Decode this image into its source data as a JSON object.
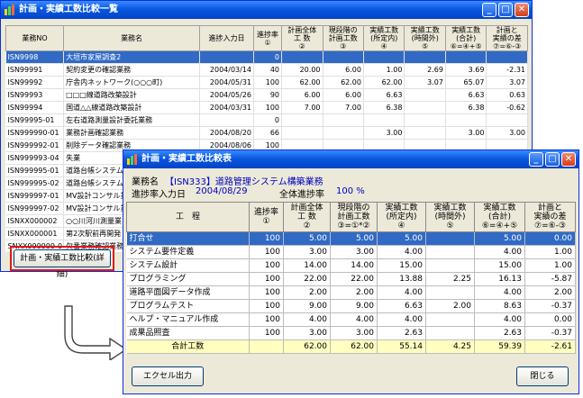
{
  "back_window": {
    "title": "計画・実績工数比較一覧",
    "headers": [
      "業務NO",
      "業務名",
      "進捗入力日",
      "進捗率\n①",
      "計画全体\n工 数\n②",
      "現段階の\n計画工数\n③",
      "実績工数\n(所定内)\n④",
      "実績工数\n(時間外)\n⑤",
      "実績工数\n(合計)\n⑥=④+⑤",
      "計画と\n実績の差\n⑦=⑥-③"
    ],
    "rows": [
      [
        "ISN9998",
        "大垣市家屋調査2",
        "",
        "0",
        "",
        "",
        "",
        "",
        "",
        ""
      ],
      [
        "ISN99991",
        "契約変更の確認業務",
        "2004/03/14",
        "40",
        "20.00",
        "6.00",
        "1.00",
        "2.69",
        "3.69",
        "-2.31"
      ],
      [
        "ISN99992",
        "庁舎内ネットワーク(○○○町)",
        "2004/05/31",
        "100",
        "62.00",
        "62.00",
        "62.00",
        "3.07",
        "65.07",
        "3.07"
      ],
      [
        "ISN99993",
        "□□□線道路改築設計",
        "2004/05/26",
        "90",
        "6.00",
        "6.00",
        "6.63",
        "",
        "6.63",
        "0.63"
      ],
      [
        "ISN99994",
        "国道△△線道路改築設計",
        "2004/03/31",
        "100",
        "7.00",
        "7.00",
        "6.38",
        "",
        "6.38",
        "-0.62"
      ],
      [
        "ISN99995-01",
        "左右道路測量設計委託業務",
        "",
        "0",
        "",
        "",
        "",
        "",
        "",
        ""
      ],
      [
        "ISN999990-01",
        "業務計画確認業務",
        "2004/08/20",
        "66",
        "",
        "",
        "3.00",
        "",
        "3.00",
        "3.00"
      ],
      [
        "ISN999992-01",
        "削除データ確認業務",
        "2004/08/06",
        "100",
        "",
        "",
        "",
        "",
        "",
        ""
      ],
      [
        "ISN999993-04",
        "失業",
        "",
        "",
        "",
        "",
        "",
        "",
        "",
        ""
      ],
      [
        "ISN999995-01",
        "道路台帳システム",
        "",
        "",
        "",
        "",
        "",
        "",
        "",
        ""
      ],
      [
        "ISN999995-02",
        "道路台帳システム",
        "",
        "",
        "",
        "",
        "",
        "",
        "",
        ""
      ],
      [
        "ISN999997-01",
        "MV設計コンサル業",
        "",
        "",
        "",
        "",
        "",
        "",
        "",
        ""
      ],
      [
        "ISN999997-02",
        "MV設計コンサル業",
        "",
        "",
        "",
        "",
        "",
        "",
        "",
        ""
      ],
      [
        "ISNXX000002",
        "○○川河川測量業",
        "",
        "",
        "",
        "",
        "",
        "",
        "",
        ""
      ],
      [
        "ISNXX000001",
        "第2次駅前再開発",
        "",
        "",
        "",
        "",
        "",
        "",
        "",
        ""
      ],
      [
        "SNXX999999-0",
        "欠番業務確認業務",
        "",
        "",
        "",
        "",
        "",
        "",
        "",
        ""
      ]
    ],
    "detail_button": "計画・実績工数比較(詳細)"
  },
  "front_window": {
    "title": "計画・実績工数比較表",
    "project_label": "業務名",
    "project_value": "【ISN333】道路管理システム構築業務",
    "progress_date_label": "進捗率入力日",
    "progress_date_value": "2004/08/29",
    "overall_progress_label": "全体進捗率",
    "overall_progress_value": "100 %",
    "headers": [
      "工　程",
      "進捗率\n①",
      "計画全体\n工 数\n②",
      "現段階の\n計画工数\n③=①*②",
      "実績工数\n(所定内)\n④",
      "実績工数\n(時間外)\n⑤",
      "実績工数\n(合計)\n⑥=④+⑤",
      "計画と\n実績の差\n⑦=⑥-③"
    ],
    "rows": [
      [
        "打合せ",
        "100",
        "5.00",
        "5.00",
        "5.00",
        "",
        "5.00",
        "0.00"
      ],
      [
        "システム要件定義",
        "100",
        "3.00",
        "3.00",
        "4.00",
        "",
        "4.00",
        "1.00"
      ],
      [
        "システム設計",
        "100",
        "14.00",
        "14.00",
        "15.00",
        "",
        "15.00",
        "1.00"
      ],
      [
        "プログラミング",
        "100",
        "22.00",
        "22.00",
        "13.88",
        "2.25",
        "16.13",
        "-5.87"
      ],
      [
        "道路平面図データ作成",
        "100",
        "2.00",
        "2.00",
        "4.00",
        "",
        "4.00",
        "2.00"
      ],
      [
        "プログラムテスト",
        "100",
        "9.00",
        "9.00",
        "6.63",
        "2.00",
        "8.63",
        "-0.37"
      ],
      [
        "ヘルプ・マニュアル作成",
        "100",
        "4.00",
        "4.00",
        "4.00",
        "",
        "4.00",
        "0.00"
      ],
      [
        "成果品照査",
        "100",
        "3.00",
        "3.00",
        "2.63",
        "",
        "2.63",
        "-0.37"
      ]
    ],
    "total_row": [
      "合計工数",
      "",
      "62.00",
      "62.00",
      "55.14",
      "4.25",
      "59.39",
      "-2.61"
    ],
    "excel_button": "エクセル出力",
    "close_button": "閉じる"
  }
}
